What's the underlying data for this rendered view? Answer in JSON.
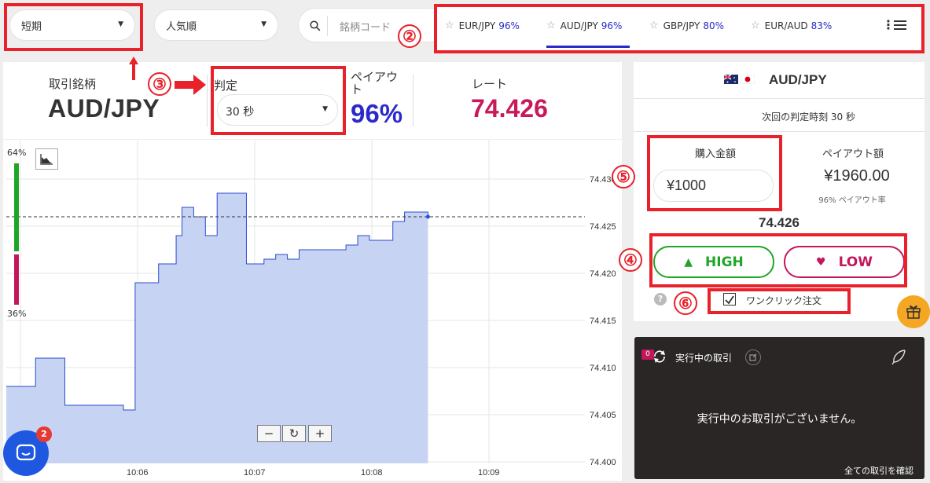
{
  "filters": {
    "duration_value": "短期",
    "sort_value": "人気順",
    "search_placeholder": "銘柄コード"
  },
  "tabs": [
    {
      "pair": "EUR/JPY",
      "payout": "96%"
    },
    {
      "pair": "AUD/JPY",
      "payout": "96%"
    },
    {
      "pair": "GBP/JPY",
      "payout": "80%"
    },
    {
      "pair": "EUR/AUD",
      "payout": "83%"
    }
  ],
  "annotations": {
    "n2": "②",
    "n3": "③",
    "n4": "④",
    "n5": "⑤",
    "n6": "⑥"
  },
  "header": {
    "instrument_label": "取引銘柄",
    "instrument_value": "AUD/JPY",
    "judge_label": "判定",
    "judge_value": "30 秒",
    "payout_label": "ペイアウト",
    "payout_value": "96%",
    "rate_label": "レート",
    "rate_value": "74.426"
  },
  "chart_data": {
    "type": "area",
    "sentiment_high": "64%",
    "sentiment_low": "36%",
    "yticks": [
      "74.430",
      "74.425",
      "74.420",
      "74.415",
      "74.410",
      "74.405",
      "74.400"
    ],
    "ylim": [
      74.4,
      74.43
    ],
    "xticks": [
      "10:06",
      "10:07",
      "10:08",
      "10:09"
    ],
    "x_minutes_since_10_05": [
      0,
      0.25,
      0.5,
      0.75,
      1.0,
      1.1,
      1.2,
      1.3,
      1.45,
      1.5,
      1.6,
      1.7,
      1.8,
      1.9,
      2.0,
      2.05,
      2.1,
      2.2,
      2.3,
      2.4,
      2.5,
      2.6,
      2.75,
      2.9,
      3.0,
      3.1,
      3.2,
      3.3,
      3.4,
      3.5,
      3.6
    ],
    "y": [
      74.408,
      74.411,
      74.406,
      74.406,
      74.4055,
      74.419,
      74.419,
      74.421,
      74.424,
      74.427,
      74.426,
      74.424,
      74.4285,
      74.4285,
      74.4285,
      74.421,
      74.421,
      74.4215,
      74.422,
      74.4215,
      74.4225,
      74.4225,
      74.4225,
      74.423,
      74.424,
      74.4235,
      74.4235,
      74.4255,
      74.4265,
      74.4265,
      74.426
    ],
    "current_rate_line": 74.426,
    "zoom_out": "−",
    "zoom_reset": "↻",
    "zoom_in": "+"
  },
  "order_panel": {
    "pair": "AUD/JPY",
    "next_judge": "次回の判定時刻 30 秒",
    "purchase_label": "購入金額",
    "purchase_value": "¥1000",
    "payout_amount_label": "ペイアウト額",
    "payout_amount_value": "¥1960.00",
    "payout_rate_text": "96% ペイアウト率",
    "current_rate": "74.426",
    "high_label": "HIGH",
    "low_label": "LOW",
    "one_click_label": "ワンクリック注文"
  },
  "trades_panel": {
    "count_badge": "0",
    "title": "実行中の取引",
    "empty_message": "実行中のお取引がございません。",
    "all_trades_link": "全ての取引を確認"
  },
  "chat": {
    "badge": "2"
  },
  "colors": {
    "accent_red": "#e8212b",
    "high_green": "#1fa628",
    "low_red": "#c2185b",
    "payout_blue": "#2a2aca",
    "rate_red": "#c8195b"
  }
}
